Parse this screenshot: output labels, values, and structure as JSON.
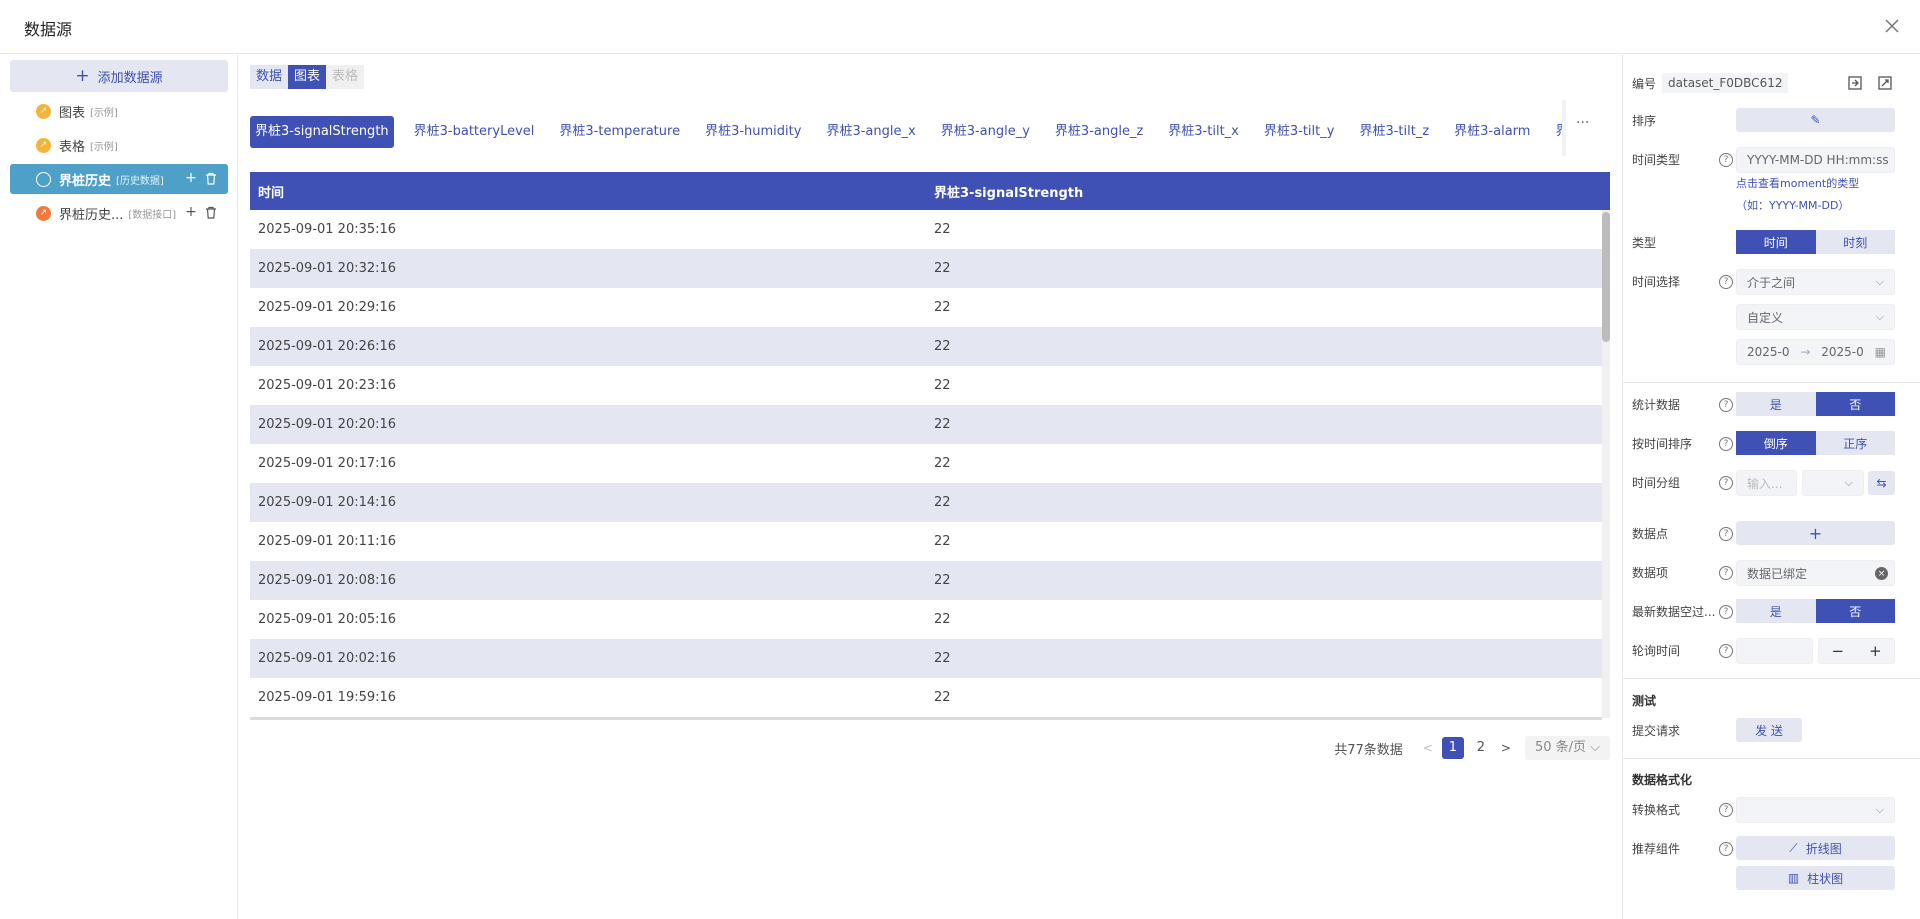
{
  "dialog": {
    "title": "数据源"
  },
  "sidebar": {
    "add_label": "添加数据源",
    "items": [
      {
        "name": "图表",
        "tag": "[示例]"
      },
      {
        "name": "表格",
        "tag": "[示例]"
      },
      {
        "name": "界桩历史",
        "tag": "[历史数据]"
      },
      {
        "name": "界桩历史...",
        "tag": "[数据接口]"
      }
    ]
  },
  "main": {
    "mode_tabs": [
      "数据",
      "图表",
      "表格"
    ],
    "series_tabs": [
      "界桩3-signalStrength",
      "界桩3-batteryLevel",
      "界桩3-temperature",
      "界桩3-humidity",
      "界桩3-angle_x",
      "界桩3-angle_y",
      "界桩3-angle_z",
      "界桩3-tilt_x",
      "界桩3-tilt_y",
      "界桩3-tilt_z",
      "界桩3-alarm",
      "界桩"
    ],
    "more": "···",
    "table": {
      "headers": [
        "时间",
        "界桩3-signalStrength"
      ],
      "rows": [
        [
          "2025-09-01 20:35:16",
          "22"
        ],
        [
          "2025-09-01 20:32:16",
          "22"
        ],
        [
          "2025-09-01 20:29:16",
          "22"
        ],
        [
          "2025-09-01 20:26:16",
          "22"
        ],
        [
          "2025-09-01 20:23:16",
          "22"
        ],
        [
          "2025-09-01 20:20:16",
          "22"
        ],
        [
          "2025-09-01 20:17:16",
          "22"
        ],
        [
          "2025-09-01 20:14:16",
          "22"
        ],
        [
          "2025-09-01 20:11:16",
          "22"
        ],
        [
          "2025-09-01 20:08:16",
          "22"
        ],
        [
          "2025-09-01 20:05:16",
          "22"
        ],
        [
          "2025-09-01 20:02:16",
          "22"
        ],
        [
          "2025-09-01 19:59:16",
          "22"
        ]
      ]
    },
    "pager": {
      "total": "共77条数据",
      "pages": [
        "1",
        "2"
      ],
      "page_size": "50 条/页"
    }
  },
  "panel": {
    "id_label": "编号",
    "id_value": "dataset_F0DBC612",
    "sort_label": "排序",
    "time_type_label": "时间类型",
    "time_type_value": "YYYY-MM-DD HH:mm:ss",
    "moment_link": "点击查看moment的类型",
    "moment_hint": "（如：YYYY-MM-DD）",
    "type_label": "类型",
    "type_options": [
      "时间",
      "时刻"
    ],
    "time_select_label": "时间选择",
    "time_select_value": "介于之间",
    "time_custom": "自定义",
    "date_start": "2025-0",
    "date_arrow": "→",
    "date_end": "2025-0",
    "stat_label": "统计数据",
    "yes": "是",
    "no": "否",
    "sort_time_label": "按时间排序",
    "sort_options": [
      "倒序",
      "正序"
    ],
    "group_label": "时间分组",
    "group_placeholder": "输入...",
    "datapoint_label": "数据点",
    "dataitem_label": "数据项",
    "dataitem_value": "数据已绑定",
    "latest_label": "最新数据空过...",
    "poll_label": "轮询时间",
    "test_title": "测试",
    "submit_label": "提交请求",
    "send_label": "发 送",
    "format_title": "数据格式化",
    "convert_label": "转换格式",
    "recommend_label": "推荐组件",
    "line_chart": "折线图",
    "bar_chart": "柱状图"
  }
}
